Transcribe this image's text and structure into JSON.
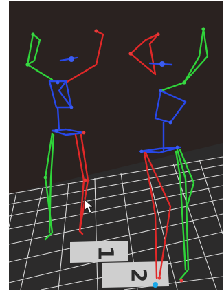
{
  "scene": {
    "description_free": true,
    "floor_markers": [
      {
        "label": "1"
      },
      {
        "label": "2"
      }
    ],
    "colors": {
      "background": "#2a2220",
      "floor": "#2c2b2b",
      "grid": "#d9d9d9",
      "left_bones": "#2fd43a",
      "right_bones": "#e02828",
      "torso_bones": "#2848e8",
      "floor_origin": "#1aa8e8"
    },
    "icons": [
      "mouse-cursor-icon"
    ]
  }
}
